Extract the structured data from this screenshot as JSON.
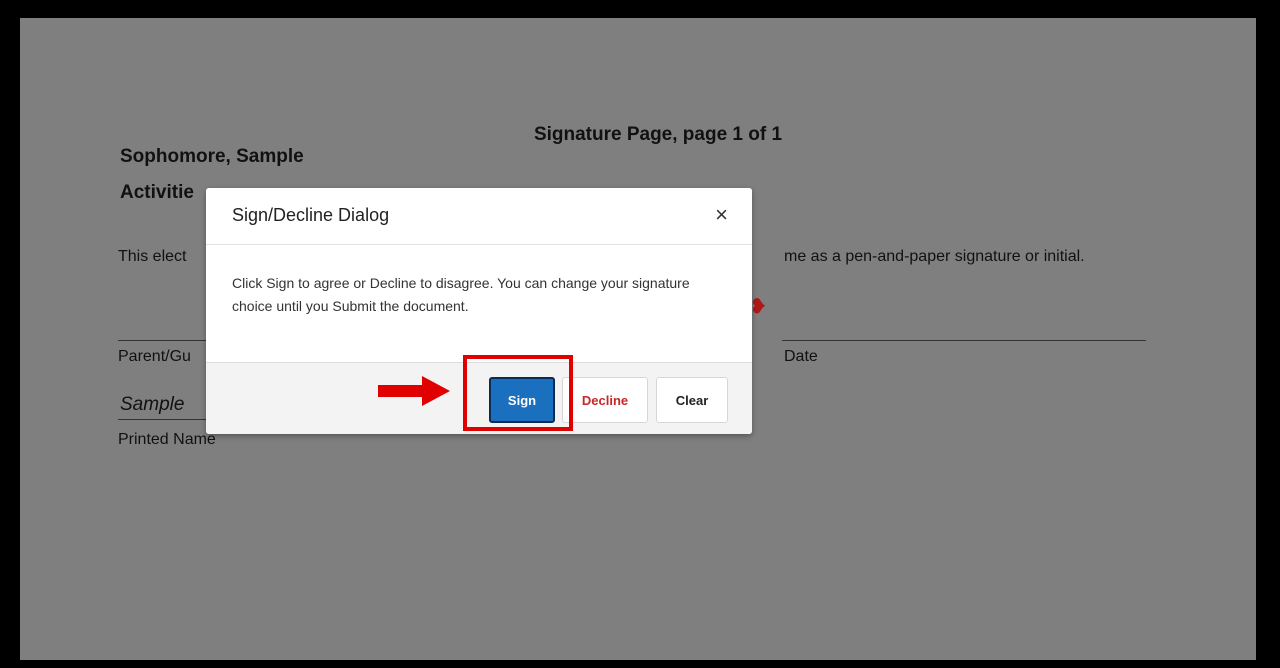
{
  "document": {
    "title": "Signature Page, page 1 of 1",
    "student_name": "Sophomore, Sample",
    "form_name_partial": "Activitie",
    "esign_text_left": "This elect",
    "esign_text_right": "me as a pen-and-paper signature or initial.",
    "signature_label_partial": "Parent/Gu",
    "date_label": "Date",
    "printed_name_value_partial": "Sample",
    "printed_name_label": "Printed Name",
    "signature_marker": "❥"
  },
  "dialog": {
    "title": "Sign/Decline Dialog",
    "close_symbol": "×",
    "message": "Click Sign to agree or Decline to disagree. You can change your signature choice until you Submit the document.",
    "buttons": {
      "sign": "Sign",
      "decline": "Decline",
      "clear": "Clear"
    }
  },
  "annotation": {
    "highlight_color": "#e00000",
    "arrow_color": "#e00000",
    "arrow_icon": "arrow-right-icon"
  },
  "colors": {
    "overlay": "#7f7f7f",
    "sign_button": "#1a6fbf",
    "decline_text": "#c62828"
  }
}
